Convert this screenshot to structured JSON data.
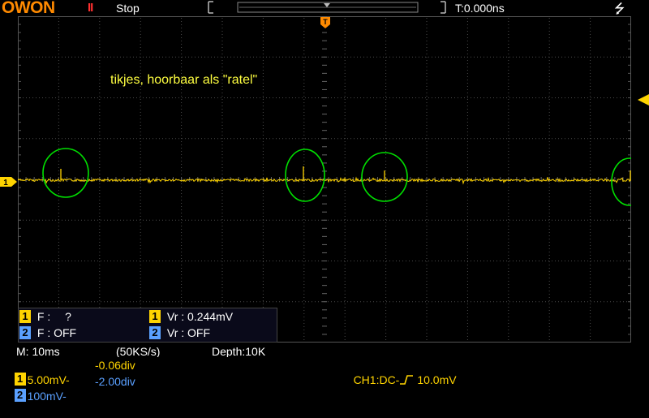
{
  "header": {
    "logo": "OWON",
    "run_icon": "II",
    "run_status": "Stop",
    "trigger_time": "T:0.000ns",
    "usb_icon": "usb-icon"
  },
  "screen": {
    "annotation": "tikjes, hoorbaar als \"ratel\"",
    "ch1_marker": "1",
    "trigger_marker": "T"
  },
  "measurements": {
    "r1": {
      "ch": "1",
      "label": "F :",
      "value": "?"
    },
    "r2": {
      "ch": "2",
      "label": "F : OFF"
    },
    "r3": {
      "ch": "1",
      "label": "Vr : 0.244mV"
    },
    "r4": {
      "ch": "2",
      "label": "Vr : OFF"
    }
  },
  "status": {
    "timebase": "M: 10ms",
    "sample_rate": "(50KS/s)",
    "depth": "Depth:10K"
  },
  "channels": {
    "ch1": {
      "num": "1",
      "scale": "5.00mV-",
      "offset": "-0.06div"
    },
    "ch2": {
      "num": "2",
      "scale": "100mV-",
      "offset": "-2.00div"
    },
    "trigger": {
      "source": "CH1:DC-",
      "edge_icon": "rising-edge-icon",
      "level": "10.0mV"
    }
  },
  "colors": {
    "ch1": "#ffd400",
    "ch2": "#5aa0ff",
    "logo": "#ff8a00",
    "annotation": "#ffff40",
    "circle": "#00e000"
  }
}
